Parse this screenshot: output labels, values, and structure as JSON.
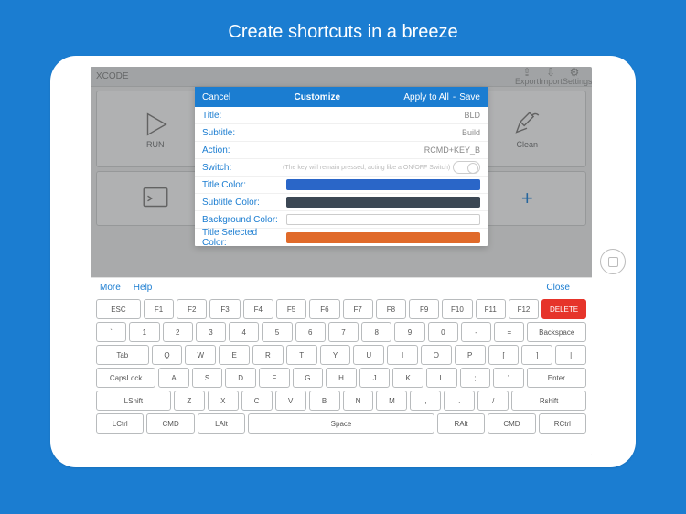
{
  "page_title": "Create shortcuts in a breeze",
  "topbar": {
    "app_name": "XCODE",
    "icons": [
      "Export",
      "Import",
      "Settings"
    ]
  },
  "tiles": {
    "run": "RUN",
    "clean": "Clean"
  },
  "modal": {
    "cancel": "Cancel",
    "heading": "Customize",
    "apply": "Apply to All",
    "save": "Save",
    "rows": {
      "title_lbl": "Title:",
      "title_val": "BLD",
      "subtitle_lbl": "Subtitle:",
      "subtitle_val": "Build",
      "action_lbl": "Action:",
      "action_val": "RCMD+KEY_B",
      "switch_lbl": "Switch:",
      "switch_hint": "(The key will remain pressed, acting like a ON/OFF Switch)",
      "title_color_lbl": "Title Color:",
      "subtitle_color_lbl": "Subtitle Color:",
      "bg_color_lbl": "Background Color:",
      "title_sel_lbl": "Title Selected Color:"
    },
    "colors": {
      "title": "#2a66c8",
      "subtitle": "#3b4754",
      "bg": "#ffffff",
      "title_sel": "#e06a2a"
    }
  },
  "kbbar": {
    "more": "More",
    "help": "Help",
    "close": "Close"
  },
  "keyboard": {
    "r1": [
      "ESC",
      "F1",
      "F2",
      "F3",
      "F4",
      "F5",
      "F6",
      "F7",
      "F8",
      "F9",
      "F10",
      "F11",
      "F12",
      "DELETE"
    ],
    "r2": [
      "`",
      "1",
      "2",
      "3",
      "4",
      "5",
      "6",
      "7",
      "8",
      "9",
      "0",
      "-",
      "=",
      "Backspace"
    ],
    "r3": [
      "Tab",
      "Q",
      "W",
      "E",
      "R",
      "T",
      "Y",
      "U",
      "I",
      "O",
      "P",
      "[",
      "]",
      "|"
    ],
    "r4": [
      "CapsLock",
      "A",
      "S",
      "D",
      "F",
      "G",
      "H",
      "J",
      "K",
      "L",
      ";",
      "'",
      "Enter"
    ],
    "r5": [
      "LShift",
      "Z",
      "X",
      "C",
      "V",
      "B",
      "N",
      "M",
      ",",
      ".",
      "/",
      "Rshift"
    ],
    "r6": [
      "LCtrl",
      "CMD",
      "LAlt",
      "Space",
      "RAlt",
      "CMD",
      "RCtrl"
    ]
  }
}
